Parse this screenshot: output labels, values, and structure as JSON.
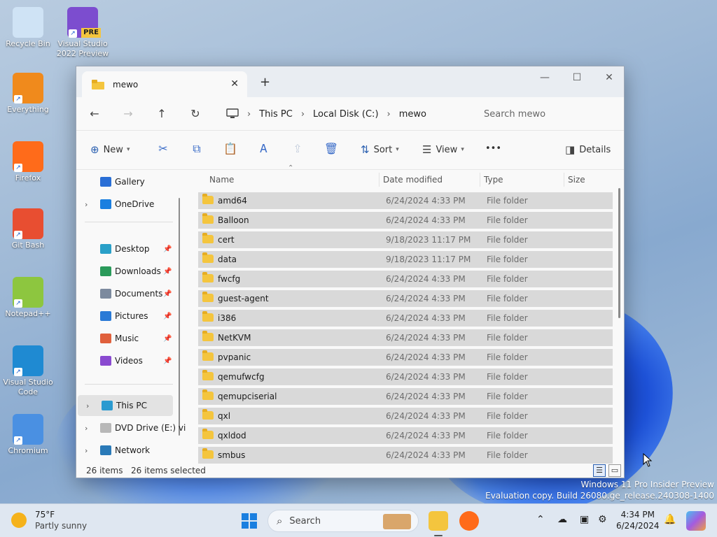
{
  "desktop": {
    "icons": [
      {
        "label": "Recycle Bin",
        "icon": "recycle-bin-icon",
        "color": "#cfe3f5"
      },
      {
        "label": "Visual Studio 2022 Preview",
        "icon": "visual-studio-preview-icon",
        "color": "#7c4dcf",
        "badge": "PRE"
      },
      {
        "label": "Everything",
        "icon": "everything-search-icon",
        "color": "#f08a1c"
      },
      {
        "label": "Firefox",
        "icon": "firefox-icon",
        "color": "#ff6b1a"
      },
      {
        "label": "Git Bash",
        "icon": "git-bash-icon",
        "color": "#e84e31"
      },
      {
        "label": "Notepad++",
        "icon": "notepad-plus-plus-icon",
        "color": "#8dc63f"
      },
      {
        "label": "Visual Studio Code",
        "icon": "vscode-icon",
        "color": "#1f8ad2"
      },
      {
        "label": "Chromium",
        "icon": "chromium-icon",
        "color": "#4a90e2"
      }
    ],
    "watermark_line1": "Windows 11 Pro Insider Preview",
    "watermark_line2": "Evaluation copy. Build 26080.ge_release.240308-1400"
  },
  "window": {
    "tab_title": "mewo",
    "new_tab_glyph": "+",
    "controls": {
      "minimize": "—",
      "maximize": "☐",
      "close": "✕"
    },
    "nav": {
      "back": "←",
      "forward": "→",
      "up": "↑",
      "refresh": "↻"
    },
    "breadcrumb": [
      "This PC",
      "Local Disk (C:)",
      "mewo"
    ],
    "search_placeholder": "Search mewo",
    "toolbar": {
      "new_label": "New",
      "sort_label": "Sort",
      "view_label": "View",
      "more_label": "•••",
      "details_label": "Details"
    },
    "sidebar": {
      "items": [
        {
          "label": "Gallery",
          "icon": "gallery-icon",
          "color": "#2a6fd6"
        },
        {
          "label": "OneDrive",
          "icon": "onedrive-icon",
          "color": "#1a7fe0"
        },
        {
          "label": "Desktop",
          "icon": "desktop-folder-icon",
          "color": "#2aa0c8"
        },
        {
          "label": "Downloads",
          "icon": "downloads-icon",
          "color": "#2a9a5a"
        },
        {
          "label": "Documents",
          "icon": "documents-icon",
          "color": "#7c8a9e"
        },
        {
          "label": "Pictures",
          "icon": "pictures-icon",
          "color": "#2a7ad6"
        },
        {
          "label": "Music",
          "icon": "music-icon",
          "color": "#e0603c"
        },
        {
          "label": "Videos",
          "icon": "videos-icon",
          "color": "#8a4ad0"
        },
        {
          "label": "This PC",
          "icon": "this-pc-icon",
          "color": "#2a9ad0"
        },
        {
          "label": "DVD Drive (E:) vi",
          "icon": "dvd-drive-icon",
          "color": "#b8b8b8"
        },
        {
          "label": "Network",
          "icon": "network-icon",
          "color": "#2a7ab8"
        }
      ],
      "pin_glyph": "📌"
    },
    "columns": {
      "name": "Name",
      "date": "Date modified",
      "type": "Type",
      "size": "Size"
    },
    "files": [
      {
        "name": "amd64",
        "date": "6/24/2024 4:33 PM",
        "type": "File folder"
      },
      {
        "name": "Balloon",
        "date": "6/24/2024 4:33 PM",
        "type": "File folder"
      },
      {
        "name": "cert",
        "date": "9/18/2023 11:17 PM",
        "type": "File folder"
      },
      {
        "name": "data",
        "date": "9/18/2023 11:17 PM",
        "type": "File folder"
      },
      {
        "name": "fwcfg",
        "date": "6/24/2024 4:33 PM",
        "type": "File folder"
      },
      {
        "name": "guest-agent",
        "date": "6/24/2024 4:33 PM",
        "type": "File folder"
      },
      {
        "name": "i386",
        "date": "6/24/2024 4:33 PM",
        "type": "File folder"
      },
      {
        "name": "NetKVM",
        "date": "6/24/2024 4:33 PM",
        "type": "File folder"
      },
      {
        "name": "pvpanic",
        "date": "6/24/2024 4:33 PM",
        "type": "File folder"
      },
      {
        "name": "qemufwcfg",
        "date": "6/24/2024 4:33 PM",
        "type": "File folder"
      },
      {
        "name": "qemupciserial",
        "date": "6/24/2024 4:33 PM",
        "type": "File folder"
      },
      {
        "name": "qxl",
        "date": "6/24/2024 4:33 PM",
        "type": "File folder"
      },
      {
        "name": "qxldod",
        "date": "6/24/2024 4:33 PM",
        "type": "File folder"
      },
      {
        "name": "smbus",
        "date": "6/24/2024 4:33 PM",
        "type": "File folder"
      }
    ],
    "status": {
      "count": "26 items",
      "selected": "26 items selected"
    }
  },
  "taskbar": {
    "weather_temp": "75°F",
    "weather_desc": "Partly sunny",
    "search_placeholder": "Search",
    "time": "4:34 PM",
    "date": "6/24/2024"
  }
}
